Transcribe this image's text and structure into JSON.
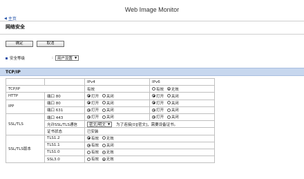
{
  "app": {
    "title": "Web Image Monitor"
  },
  "nav": {
    "back_label": "主页"
  },
  "page": {
    "title": "网络安全"
  },
  "buttons": {
    "ok": "确定",
    "cancel": "取消"
  },
  "security_level": {
    "label": "安全等级",
    "colon": ":",
    "value": "用户设置"
  },
  "section": {
    "title": "TCP/IP"
  },
  "table": {
    "header": {
      "ipv4": "IPv4",
      "ipv6": "IPv6"
    },
    "tcpip": {
      "label": "TCP/IP",
      "ipv4_text": "有效",
      "ipv6_opt1": "有效",
      "ipv6_opt2": "无效"
    },
    "http": {
      "label": "HTTP",
      "port": "端口 80",
      "on": "打开",
      "off": "关闭"
    },
    "ipp": {
      "label": "IPP",
      "port80": "端口 80",
      "port631": "端口 631",
      "on": "打开",
      "off": "关闭"
    },
    "ssl": {
      "label": "SSL/TLS",
      "port": "端口 443",
      "allow_label": "允许SSL/TLS通信",
      "allow_value": "密文/明文",
      "allow_note": "为了连接[0][密文]，需要设备证书。",
      "cert_label": "证书状态",
      "cert_value": "已安装",
      "on": "打开",
      "off": "关闭"
    },
    "versions": {
      "label": "SSL/TLS版本",
      "rows": [
        {
          "name": "TLS1.2",
          "opt1": "有效",
          "opt2": "无效",
          "selected": 1
        },
        {
          "name": "TLS1.1",
          "opt1": "有效",
          "opt2": "关闭",
          "selected": 1
        },
        {
          "name": "TLS1.0",
          "opt1": "有效",
          "opt2": "无效",
          "selected": 2
        },
        {
          "name": "SSL3.0",
          "opt1": "有效",
          "opt2": "无效",
          "selected": 2
        }
      ]
    }
  }
}
